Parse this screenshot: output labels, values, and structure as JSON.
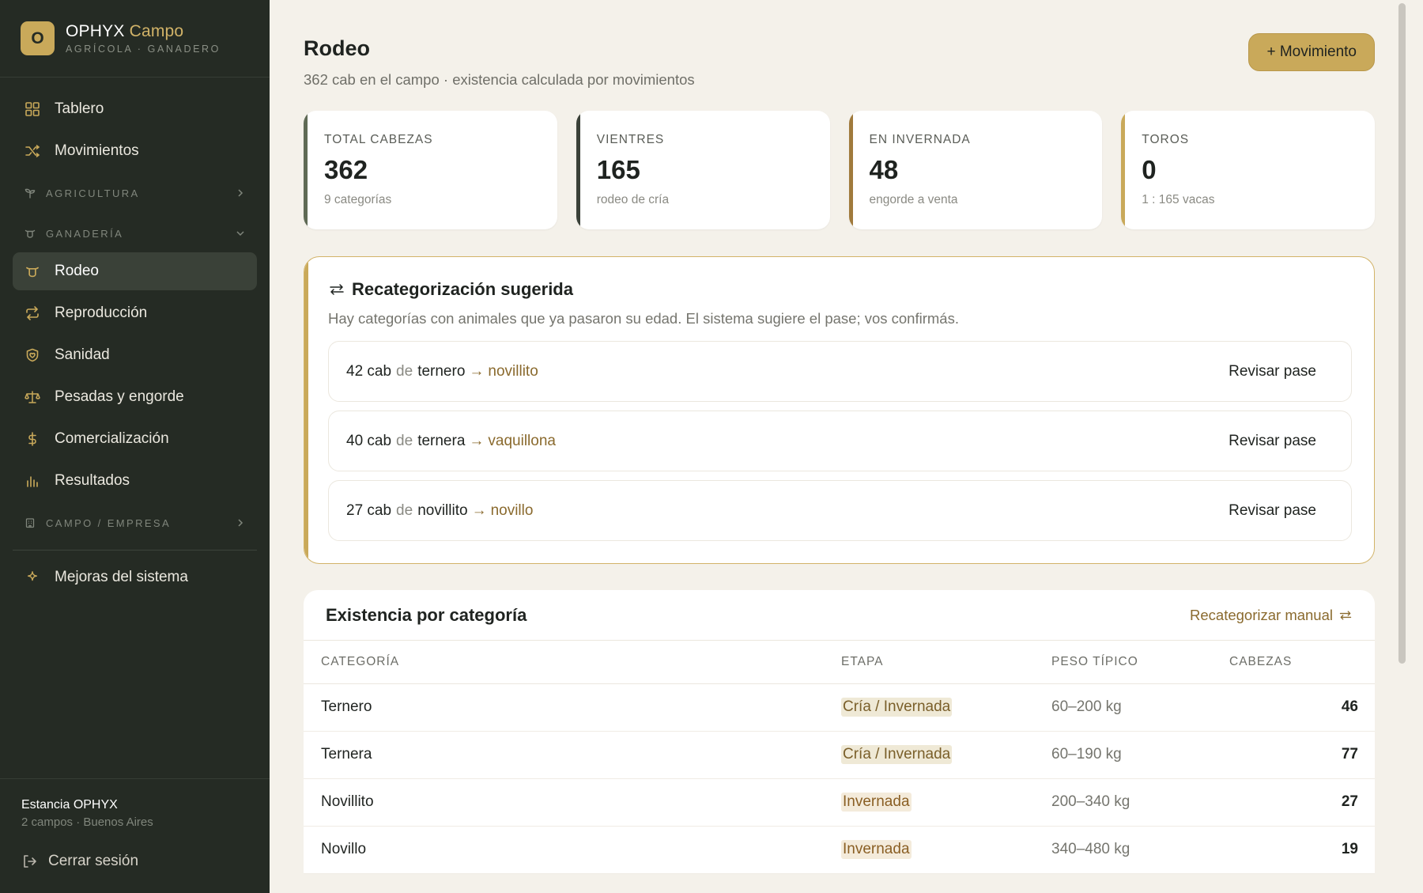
{
  "brand": {
    "initial": "O",
    "name": "OPHYX",
    "name_accent": "Campo",
    "subtitle": "AGRÍCOLA · GANADERO"
  },
  "sidebar": {
    "top_items": [
      {
        "label": "Tablero",
        "icon": "grid-icon"
      },
      {
        "label": "Movimientos",
        "icon": "shuffle-icon"
      }
    ],
    "section_agricultura": {
      "label": "AGRICULTURA",
      "icon": "sprout-icon",
      "state": "collapsed"
    },
    "section_ganaderia": {
      "label": "GANADERÍA",
      "icon": "cow-icon",
      "state": "expanded"
    },
    "ganaderia_items": [
      {
        "label": "Rodeo",
        "icon": "cow-icon",
        "active": true
      },
      {
        "label": "Reproducción",
        "icon": "repeat-icon"
      },
      {
        "label": "Sanidad",
        "icon": "heart-shield-icon"
      },
      {
        "label": "Pesadas y engorde",
        "icon": "scale-icon"
      },
      {
        "label": "Comercialización",
        "icon": "dollar-icon"
      },
      {
        "label": "Resultados",
        "icon": "bar-chart-icon"
      }
    ],
    "section_campo": {
      "label": "CAMPO / EMPRESA",
      "icon": "building-icon",
      "state": "collapsed"
    },
    "bottom_item": {
      "label": "Mejoras del sistema",
      "icon": "sparkle-icon"
    },
    "footer": {
      "estancia": "Estancia OPHYX",
      "estancia_sub": "2 campos · Buenos Aires",
      "logout": "Cerrar sesión"
    }
  },
  "header": {
    "title": "Rodeo",
    "subtitle": "362 cab en el campo · existencia calculada por movimientos",
    "primary_button": "+ Movimiento"
  },
  "stats": [
    {
      "label": "TOTAL CABEZAS",
      "value": "362",
      "sub": "9 categorías",
      "color": "#5f6a55"
    },
    {
      "label": "VIENTRES",
      "value": "165",
      "sub": "rodeo de cría",
      "color": "#3a4138"
    },
    {
      "label": "EN INVERNADA",
      "value": "48",
      "sub": "engorde a venta",
      "color": "#a07a3c"
    },
    {
      "label": "TOROS",
      "value": "0",
      "sub": "1 : 165 vacas",
      "color": "#c9a95a"
    }
  ],
  "suggestion": {
    "title": "Recategorización sugerida",
    "description": "Hay categorías con animales que ya pasaron su edad. El sistema sugiere el pase; vos confirmás.",
    "connector": "de",
    "button_label": "Revisar pase",
    "rows": [
      {
        "count": "42 cab",
        "from": "ternero",
        "to": "novillito"
      },
      {
        "count": "40 cab",
        "from": "ternera",
        "to": "vaquillona"
      },
      {
        "count": "27 cab",
        "from": "novillito",
        "to": "novillo"
      }
    ]
  },
  "table": {
    "title": "Existencia por categoría",
    "action": "Recategorizar manual",
    "columns": [
      "CATEGORÍA",
      "ETAPA",
      "PESO TÍPICO",
      "CABEZAS"
    ],
    "rows": [
      {
        "category": "Ternero",
        "stage": "Cría / Invernada",
        "weight": "60–200 kg",
        "heads": "46"
      },
      {
        "category": "Ternera",
        "stage": "Cría / Invernada",
        "weight": "60–190 kg",
        "heads": "77"
      },
      {
        "category": "Novillito",
        "stage": "Invernada",
        "weight": "200–340 kg",
        "heads": "27"
      },
      {
        "category": "Novillo",
        "stage": "Invernada",
        "weight": "340–480 kg",
        "heads": "19"
      }
    ]
  },
  "colors": {
    "sidebar_bg": "#252b24",
    "accent": "#c9a95a",
    "page_bg": "#f4f1ea",
    "link": "#8a6a2e"
  }
}
